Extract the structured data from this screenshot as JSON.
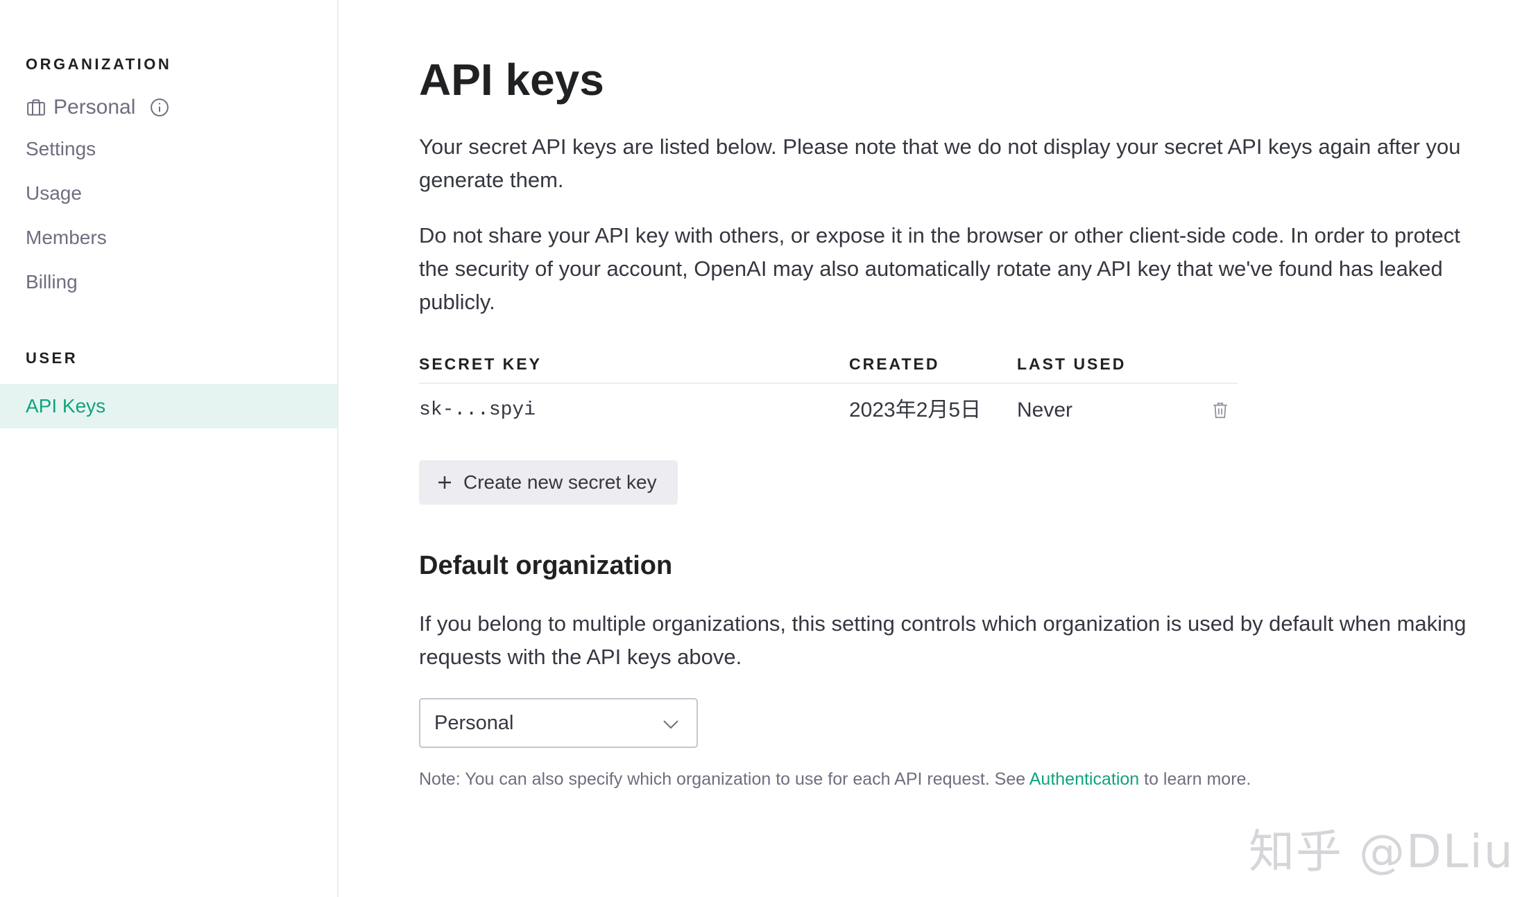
{
  "sidebar": {
    "organization_heading": "ORGANIZATION",
    "organization_name": "Personal",
    "org_icon": "briefcase-icon",
    "info_icon": "info-icon",
    "org_items": [
      {
        "label": "Settings"
      },
      {
        "label": "Usage"
      },
      {
        "label": "Members"
      },
      {
        "label": "Billing"
      }
    ],
    "user_heading": "USER",
    "user_items": [
      {
        "label": "API Keys",
        "active": true
      }
    ]
  },
  "main": {
    "title": "API keys",
    "intro_paragraph": "Your secret API keys are listed below. Please note that we do not display your secret API keys again after you generate them.",
    "security_paragraph": "Do not share your API key with others, or expose it in the browser or other client-side code. In order to protect the security of your account, OpenAI may also automatically rotate any API key that we've found has leaked publicly.",
    "table": {
      "columns": [
        "SECRET KEY",
        "CREATED",
        "LAST USED"
      ],
      "rows": [
        {
          "secret_key": "sk-...spyi",
          "created": "2023年2月5日",
          "last_used": "Never"
        }
      ]
    },
    "create_button_label": "Create new secret key",
    "default_org_title": "Default organization",
    "default_org_paragraph": "If you belong to multiple organizations, this setting controls which organization is used by default when making requests with the API keys above.",
    "default_org_select_value": "Personal",
    "note_prefix": "Note: You can also specify which organization to use for each API request. See ",
    "note_link": "Authentication",
    "note_suffix": " to learn more."
  },
  "watermark": "知乎 @DLiu",
  "colors": {
    "accent": "#10a37f",
    "active_bg": "#e6f4f1",
    "muted_text": "#6e6e80",
    "button_bg": "#ececf1"
  }
}
